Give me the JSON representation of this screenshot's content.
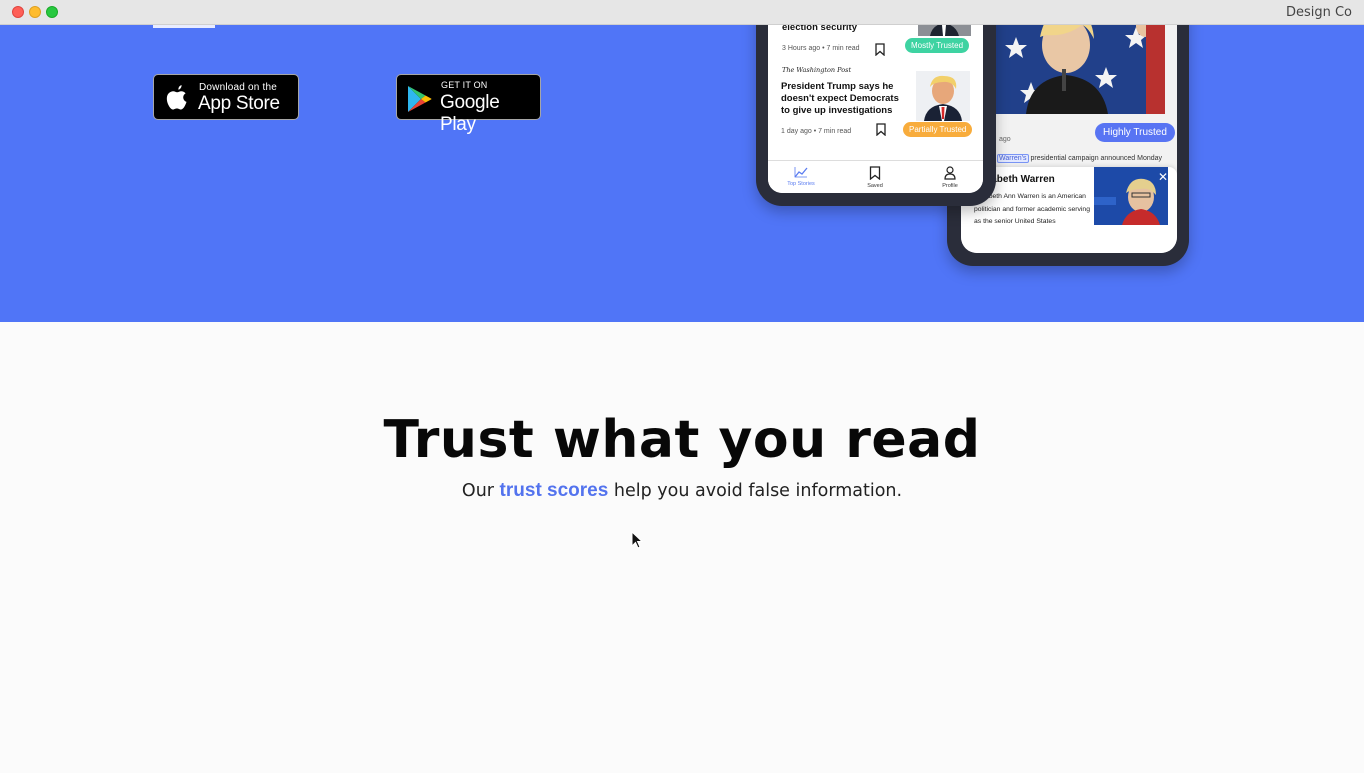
{
  "window": {
    "app_name": "Design Co"
  },
  "hero": {
    "app_store": {
      "small": "Download on the",
      "big": "App Store",
      "icon": "apple-icon"
    },
    "google_play": {
      "small": "GET IT ON",
      "big": "Google Play",
      "icon": "google-play-icon"
    },
    "phone_left": {
      "article1": {
        "title": "hours stopped bills aimed at election security",
        "meta": "3 Hours ago  •  7 min read",
        "badge": "Mostly Trusted"
      },
      "article2": {
        "source": "The Washington Post",
        "title": "President Trump says he doesn't expect Democrats to give up investigations",
        "meta": "1 day ago  •  7 min read",
        "badge": "Partially Trusted"
      },
      "tabs": [
        {
          "label": "Top Stories",
          "icon": "trending-chart-icon"
        },
        {
          "label": "Saved",
          "icon": "bookmark-icon"
        },
        {
          "label": "Profile",
          "icon": "person-icon"
        }
      ]
    },
    "phone_right": {
      "time_fragment": "ago",
      "badge": "Highly Trusted",
      "caption_highlight": "Warren's",
      "caption_rest": "presidential campaign announced Monday",
      "card": {
        "title": "Elizabeth Warren",
        "text": "Elizabeth Ann Warren is an American politician and former academic serving as the senior United States"
      }
    }
  },
  "main": {
    "headline": "Trust what you read",
    "sub_before": "Our ",
    "sub_accent": "trust scores",
    "sub_after": " help you avoid false information."
  },
  "colors": {
    "hero_blue": "#5075f7",
    "accent": "#5373ee",
    "mostly_trusted": "#3ed3a2",
    "partially_trusted": "#f8ac3c",
    "highly_trusted": "#5874f3"
  }
}
